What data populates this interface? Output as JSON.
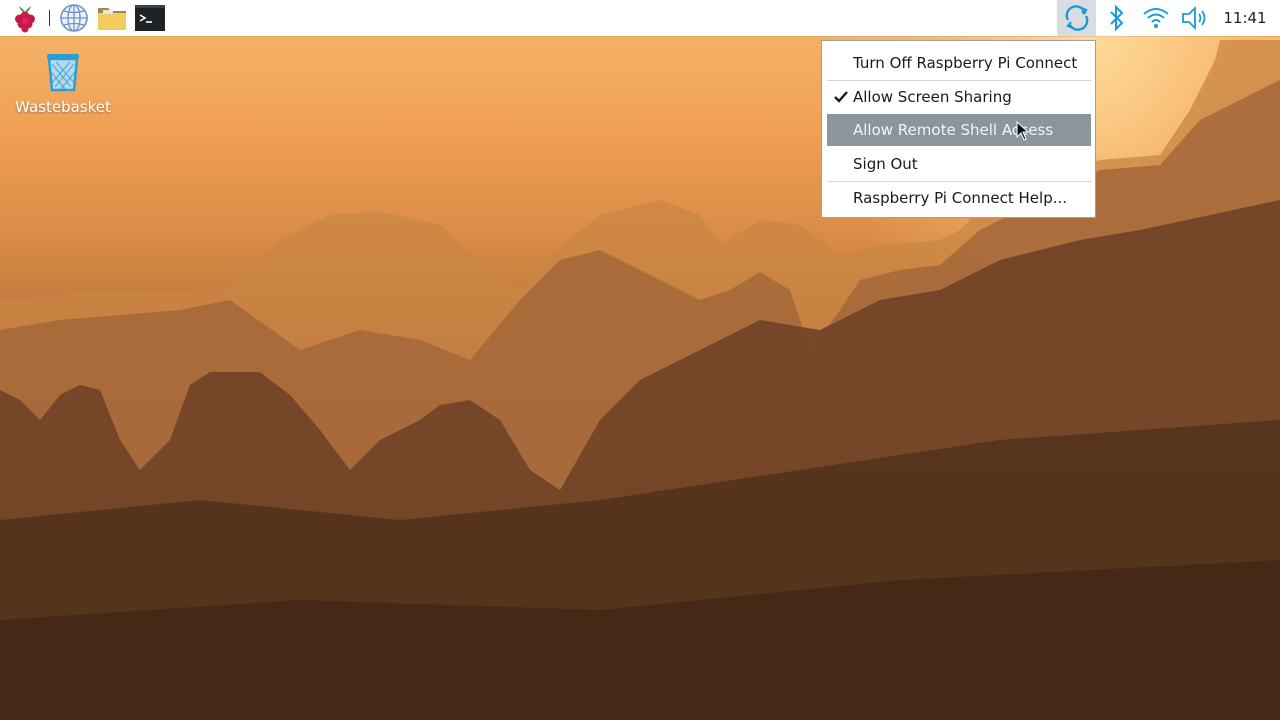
{
  "taskbar": {
    "launchers": [
      {
        "name": "raspberry-menu",
        "icon": "raspberry-icon"
      },
      {
        "name": "web-browser",
        "icon": "globe-icon"
      },
      {
        "name": "file-manager",
        "icon": "folder-icon"
      },
      {
        "name": "terminal",
        "icon": "terminal-icon"
      }
    ],
    "tray": {
      "icons": [
        "connect-icon",
        "bluetooth-icon",
        "wifi-icon",
        "volume-icon"
      ],
      "clock": "11:41"
    }
  },
  "desktop": {
    "icons": [
      {
        "label": "Wastebasket",
        "icon": "trash-icon"
      }
    ]
  },
  "connect_menu": {
    "items": [
      {
        "label": "Turn Off Raspberry Pi Connect",
        "checked": false,
        "highlighted": false
      },
      {
        "label": "Allow Screen Sharing",
        "checked": true,
        "highlighted": false
      },
      {
        "label": "Allow Remote Shell Access",
        "checked": false,
        "highlighted": true
      },
      {
        "label": "Sign Out",
        "checked": false,
        "highlighted": false
      },
      {
        "label": "Raspberry Pi Connect Help...",
        "checked": false,
        "highlighted": false
      }
    ]
  },
  "colors": {
    "accent": "#1b9bd7",
    "menu_highlight": "#8a959e",
    "taskbar": "#ffffff"
  }
}
